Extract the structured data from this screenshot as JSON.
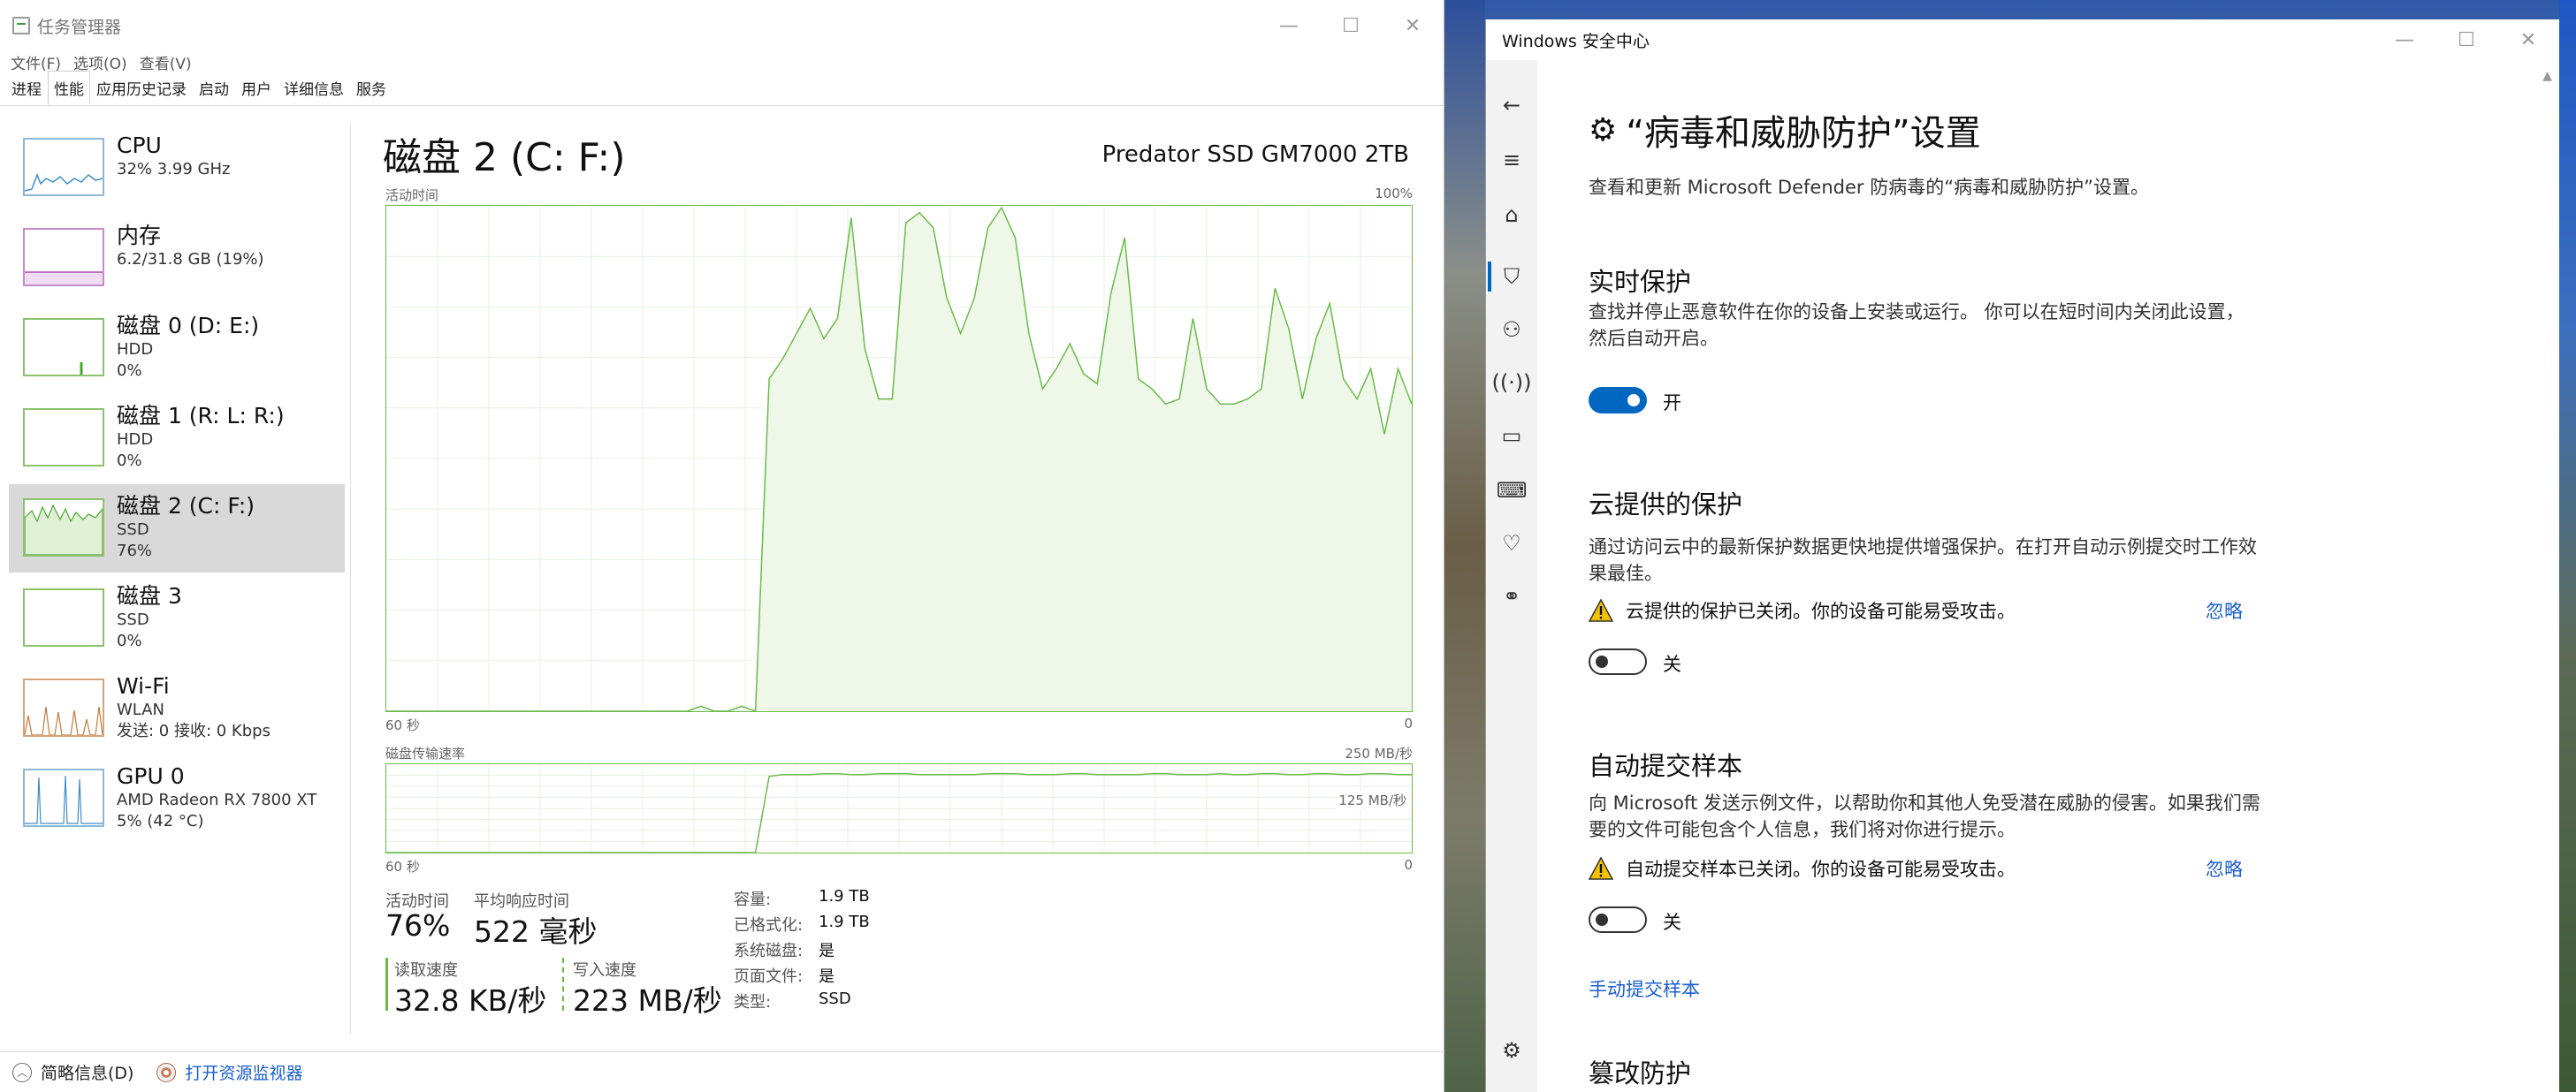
{
  "task_manager": {
    "title": "任务管理器",
    "menu": [
      "文件(F)",
      "选项(O)",
      "查看(V)"
    ],
    "tabs": [
      "进程",
      "性能",
      "应用历史记录",
      "启动",
      "用户",
      "详细信息",
      "服务"
    ],
    "active_tab": "性能",
    "sidebar": [
      {
        "title": "CPU",
        "sub1": "32%  3.99 GHz",
        "sub2": ""
      },
      {
        "title": "内存",
        "sub1": "6.2/31.8 GB (19%)",
        "sub2": ""
      },
      {
        "title": "磁盘 0 (D: E:)",
        "sub1": "HDD",
        "sub2": "0%"
      },
      {
        "title": "磁盘 1 (R: L: R:)",
        "sub1": "HDD",
        "sub2": "0%"
      },
      {
        "title": "磁盘 2 (C: F:)",
        "sub1": "SSD",
        "sub2": "76%"
      },
      {
        "title": "磁盘 3",
        "sub1": "SSD",
        "sub2": "0%"
      },
      {
        "title": "Wi-Fi",
        "sub1": "WLAN",
        "sub2": "发送: 0 接收: 0 Kbps"
      },
      {
        "title": "GPU 0",
        "sub1": "AMD Radeon RX 7800 XT",
        "sub2": "5% (42 °C)"
      }
    ],
    "selected_index": 4,
    "main": {
      "title": "磁盘 2 (C: F:)",
      "model": "Predator SSD GM7000 2TB",
      "graph1": {
        "label": "活动时间",
        "max_label": "100%",
        "x_left": "60 秒",
        "x_right": "0"
      },
      "graph2": {
        "label": "磁盘传输速率",
        "max_label": "250 MB/秒",
        "mid_label": "125 MB/秒",
        "x_left": "60 秒",
        "x_right": "0"
      },
      "stats": {
        "active_time_label": "活动时间",
        "active_time": "76%",
        "avg_response_label": "平均响应时间",
        "avg_response": "522 毫秒",
        "read_label": "读取速度",
        "read": "32.8 KB/秒",
        "write_label": "写入速度",
        "write": "223 MB/秒"
      },
      "props": [
        {
          "k": "容量:",
          "v": "1.9 TB"
        },
        {
          "k": "已格式化:",
          "v": "1.9 TB"
        },
        {
          "k": "系统磁盘:",
          "v": "是"
        },
        {
          "k": "页面文件:",
          "v": "是"
        },
        {
          "k": "类型:",
          "v": "SSD"
        }
      ]
    },
    "footer": {
      "brief": "简略信息(D)",
      "resmon": "打开资源监视器"
    }
  },
  "activity_series": [
    0,
    0,
    0,
    0,
    0,
    0,
    0,
    0,
    0,
    0,
    0,
    0,
    0,
    0,
    0,
    0,
    0,
    0,
    0,
    0,
    0,
    0,
    0,
    1,
    0,
    0,
    1,
    0,
    66,
    70,
    75,
    80,
    74,
    78,
    98,
    72,
    62,
    62,
    97,
    99,
    96,
    82,
    75,
    82,
    96,
    100,
    94,
    75,
    64,
    68,
    73,
    67,
    65,
    83,
    94,
    66,
    64,
    61,
    62,
    78,
    64,
    61,
    61,
    62,
    64,
    84,
    76,
    62,
    74,
    81,
    66,
    62,
    68,
    55,
    68,
    61
  ],
  "transfer_series": [
    0,
    0,
    0,
    0,
    0,
    0,
    0,
    0,
    0,
    0,
    0,
    0,
    0,
    0,
    0,
    0,
    0,
    0,
    0,
    0,
    0,
    0,
    0,
    0,
    0,
    0,
    0,
    0,
    88,
    90,
    90,
    90,
    91,
    91,
    90,
    90,
    91,
    91,
    91,
    90,
    90,
    90,
    90,
    90,
    91,
    91,
    91,
    90,
    90,
    90,
    91,
    91,
    90,
    90,
    90,
    90,
    91,
    91,
    90,
    90,
    90,
    91,
    90,
    90,
    91,
    91,
    90,
    90,
    91,
    91,
    90,
    90,
    91,
    91,
    90,
    90
  ],
  "security": {
    "title": "Windows 安全中心",
    "heading": "“病毒和威胁防护”设置",
    "intro": "查看和更新 Microsoft Defender 防病毒的“病毒和威胁防护”设置。",
    "realtime": {
      "title": "实时保护",
      "desc": "查找并停止恶意软件在你的设备上安装或运行。 你可以在短时间内关闭此设置，然后自动开启。",
      "state": "开"
    },
    "cloud": {
      "title": "云提供的保护",
      "desc": "通过访问云中的最新保护数据更快地提供增强保护。在打开自动示例提交时工作效果最佳。",
      "warning": "云提供的保护已关闭。你的设备可能易受攻击。",
      "ignore": "忽略",
      "state": "关"
    },
    "sample": {
      "title": "自动提交样本",
      "desc": "向 Microsoft 发送示例文件，以帮助你和其他人免受潜在威胁的侵害。如果我们需要的文件可能包含个人信息，我们将对你进行提示。",
      "warning": "自动提交样本已关闭。你的设备可能易受攻击。",
      "ignore": "忽略",
      "state": "关",
      "link": "手动提交样本"
    },
    "tamper": {
      "title": "篡改防护"
    },
    "colors": {
      "accent": "#0067c0",
      "link": "#1a5ecf",
      "warning": "#f2c200"
    }
  }
}
